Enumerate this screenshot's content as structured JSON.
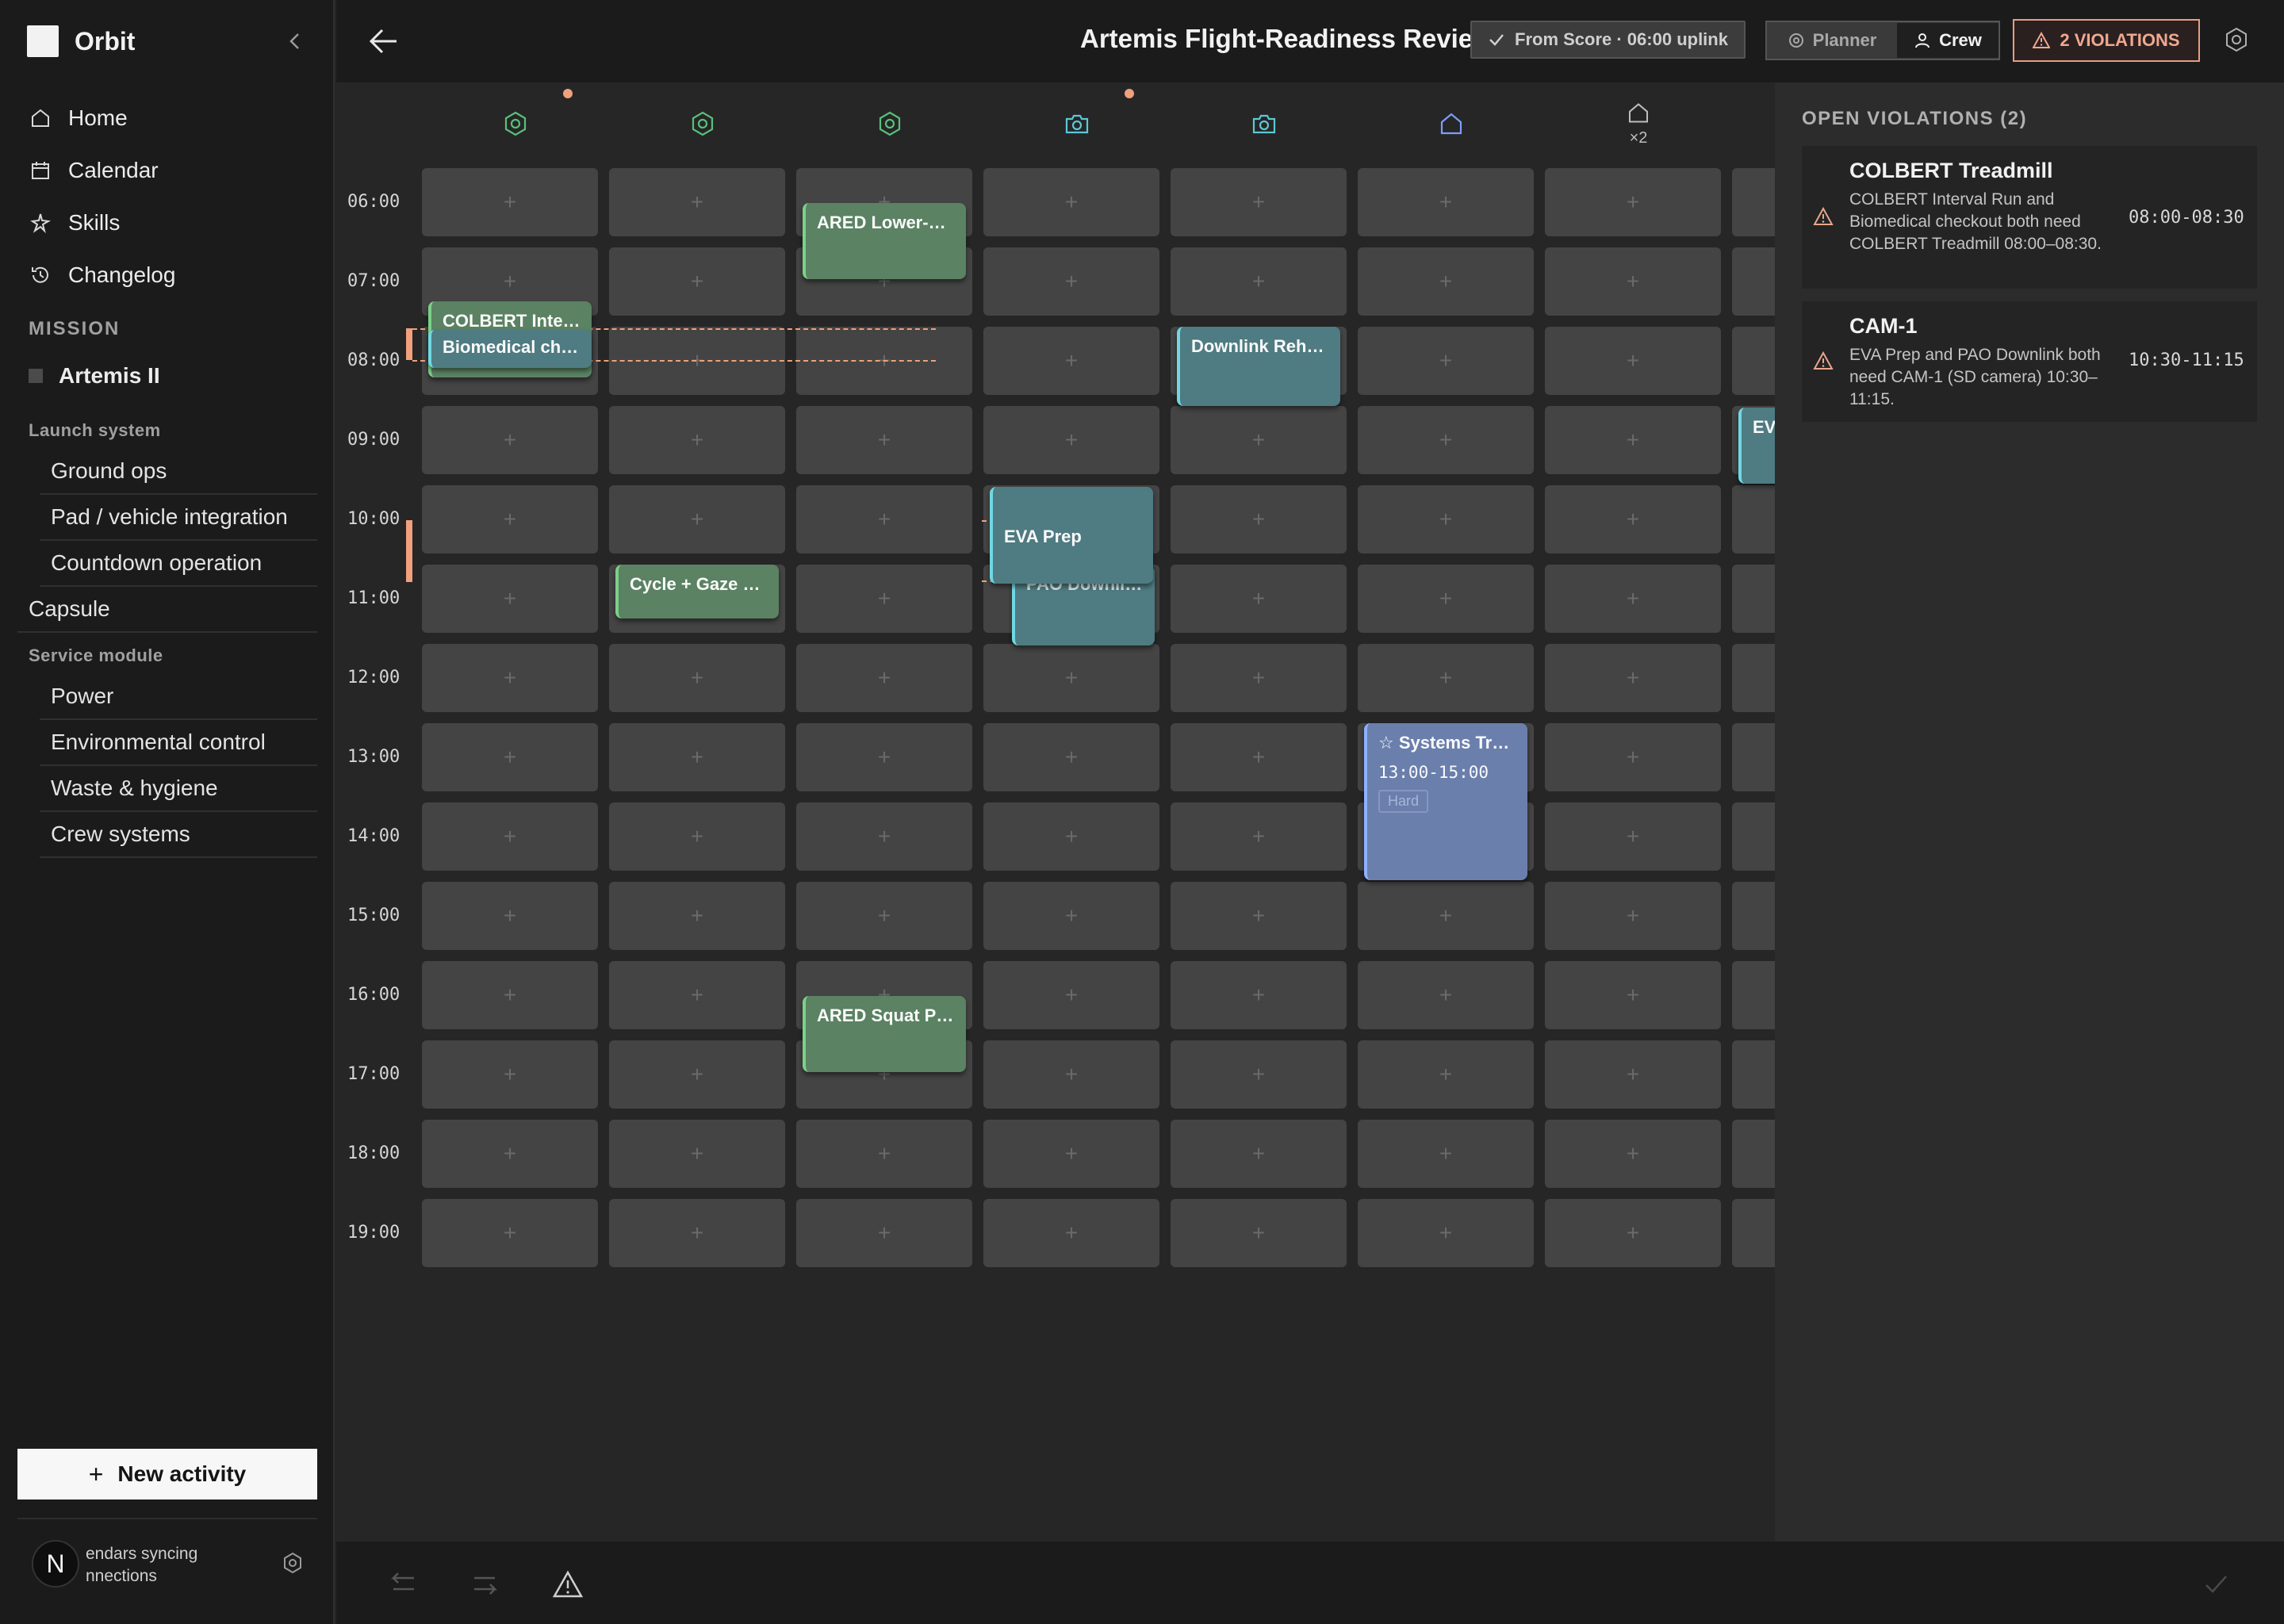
{
  "app": {
    "name": "Orbit"
  },
  "nav": [
    {
      "label": "Home",
      "icon": "home-icon"
    },
    {
      "label": "Calendar",
      "icon": "calendar-icon"
    },
    {
      "label": "Skills",
      "icon": "skills-icon"
    },
    {
      "label": "Changelog",
      "icon": "history-icon"
    }
  ],
  "mission": {
    "heading": "MISSION",
    "name": "Artemis II",
    "tree": {
      "launch_group": "Launch system",
      "launch_items": [
        "Ground ops",
        "Pad / vehicle integration",
        "Countdown operation"
      ],
      "capsule": "Capsule",
      "service_group": "Service module",
      "service_items": [
        "Power",
        "Environmental control",
        "Waste & hygiene",
        "Crew systems"
      ]
    }
  },
  "new_activity": {
    "label": "New activity"
  },
  "sync": {
    "avatar": "N",
    "line1": "endars syncing",
    "line2": "nnections"
  },
  "header": {
    "title": "Artemis Flight-Readiness Review",
    "score_pill": "From Score · 06:00 uplink",
    "mode_planner": "Planner",
    "mode_crew": "Crew",
    "mode_selected": "Crew",
    "violations_button": "2 VIOLATIONS"
  },
  "columns": [
    {
      "icon": "hexagon-gear-icon",
      "color": "#58c07a",
      "dot": true
    },
    {
      "icon": "hexagon-gear-icon",
      "color": "#58c07a",
      "dot": false
    },
    {
      "icon": "hexagon-gear-icon",
      "color": "#58c07a",
      "dot": false
    },
    {
      "icon": "camera-icon",
      "color": "#5cc8d6",
      "dot": true
    },
    {
      "icon": "camera-icon",
      "color": "#5cc8d6",
      "dot": false
    },
    {
      "icon": "house-icon",
      "color": "#7f9cff",
      "dot": false
    },
    {
      "icon": "house-icon",
      "color": "#bdbdbd",
      "dot": false,
      "sub": "×2"
    },
    {
      "icon": "",
      "color": "",
      "dot": false
    }
  ],
  "hours": [
    "06:00",
    "07:00",
    "08:00",
    "09:00",
    "10:00",
    "11:00",
    "12:00",
    "13:00",
    "14:00",
    "15:00",
    "16:00",
    "17:00",
    "18:00",
    "19:00"
  ],
  "events": [
    {
      "id": "ev-colbert",
      "title": "COLBERT Inte…",
      "kind": "green"
    },
    {
      "id": "ev-biomed",
      "title": "Biomedical ch…",
      "kind": "teal"
    },
    {
      "id": "ev-ared-lower",
      "title": "ARED Lower-B…",
      "kind": "green"
    },
    {
      "id": "ev-cycle",
      "title": "Cycle + Gaze …",
      "kind": "green"
    },
    {
      "id": "ev-pao",
      "title": "PAO Downli…",
      "kind": "teal"
    },
    {
      "id": "ev-eva-prep",
      "title": "EVA Prep",
      "kind": "teal"
    },
    {
      "id": "ev-downlink",
      "title": "Downlink Reh…",
      "kind": "teal"
    },
    {
      "id": "ev-systems",
      "title": "Systems Tr…",
      "time": "13:00-15:00",
      "tag": "Hard",
      "kind": "blue"
    },
    {
      "id": "ev-ared-squat",
      "title": "ARED Squat P…",
      "kind": "green"
    },
    {
      "id": "ev-eva-edge",
      "title": "EV",
      "kind": "teal"
    }
  ],
  "violations": {
    "heading": "OPEN VIOLATIONS (2)",
    "items": [
      {
        "title": "COLBERT Treadmill",
        "desc": "COLBERT Interval Run and Biomedical checkout both need COLBERT Treadmill 08:00–08:30.",
        "time": "08:00-08:30"
      },
      {
        "title": "CAM-1",
        "desc": "EVA Prep and PAO Downlink both need CAM-1 (SD camera) 10:30–11:15.",
        "time": "10:30-11:15"
      }
    ]
  },
  "colors": {
    "accent_warning": "#f0a07c",
    "green_event": "#5a8263",
    "teal_event": "#4f7b82",
    "blue_event": "#6a7fac"
  }
}
